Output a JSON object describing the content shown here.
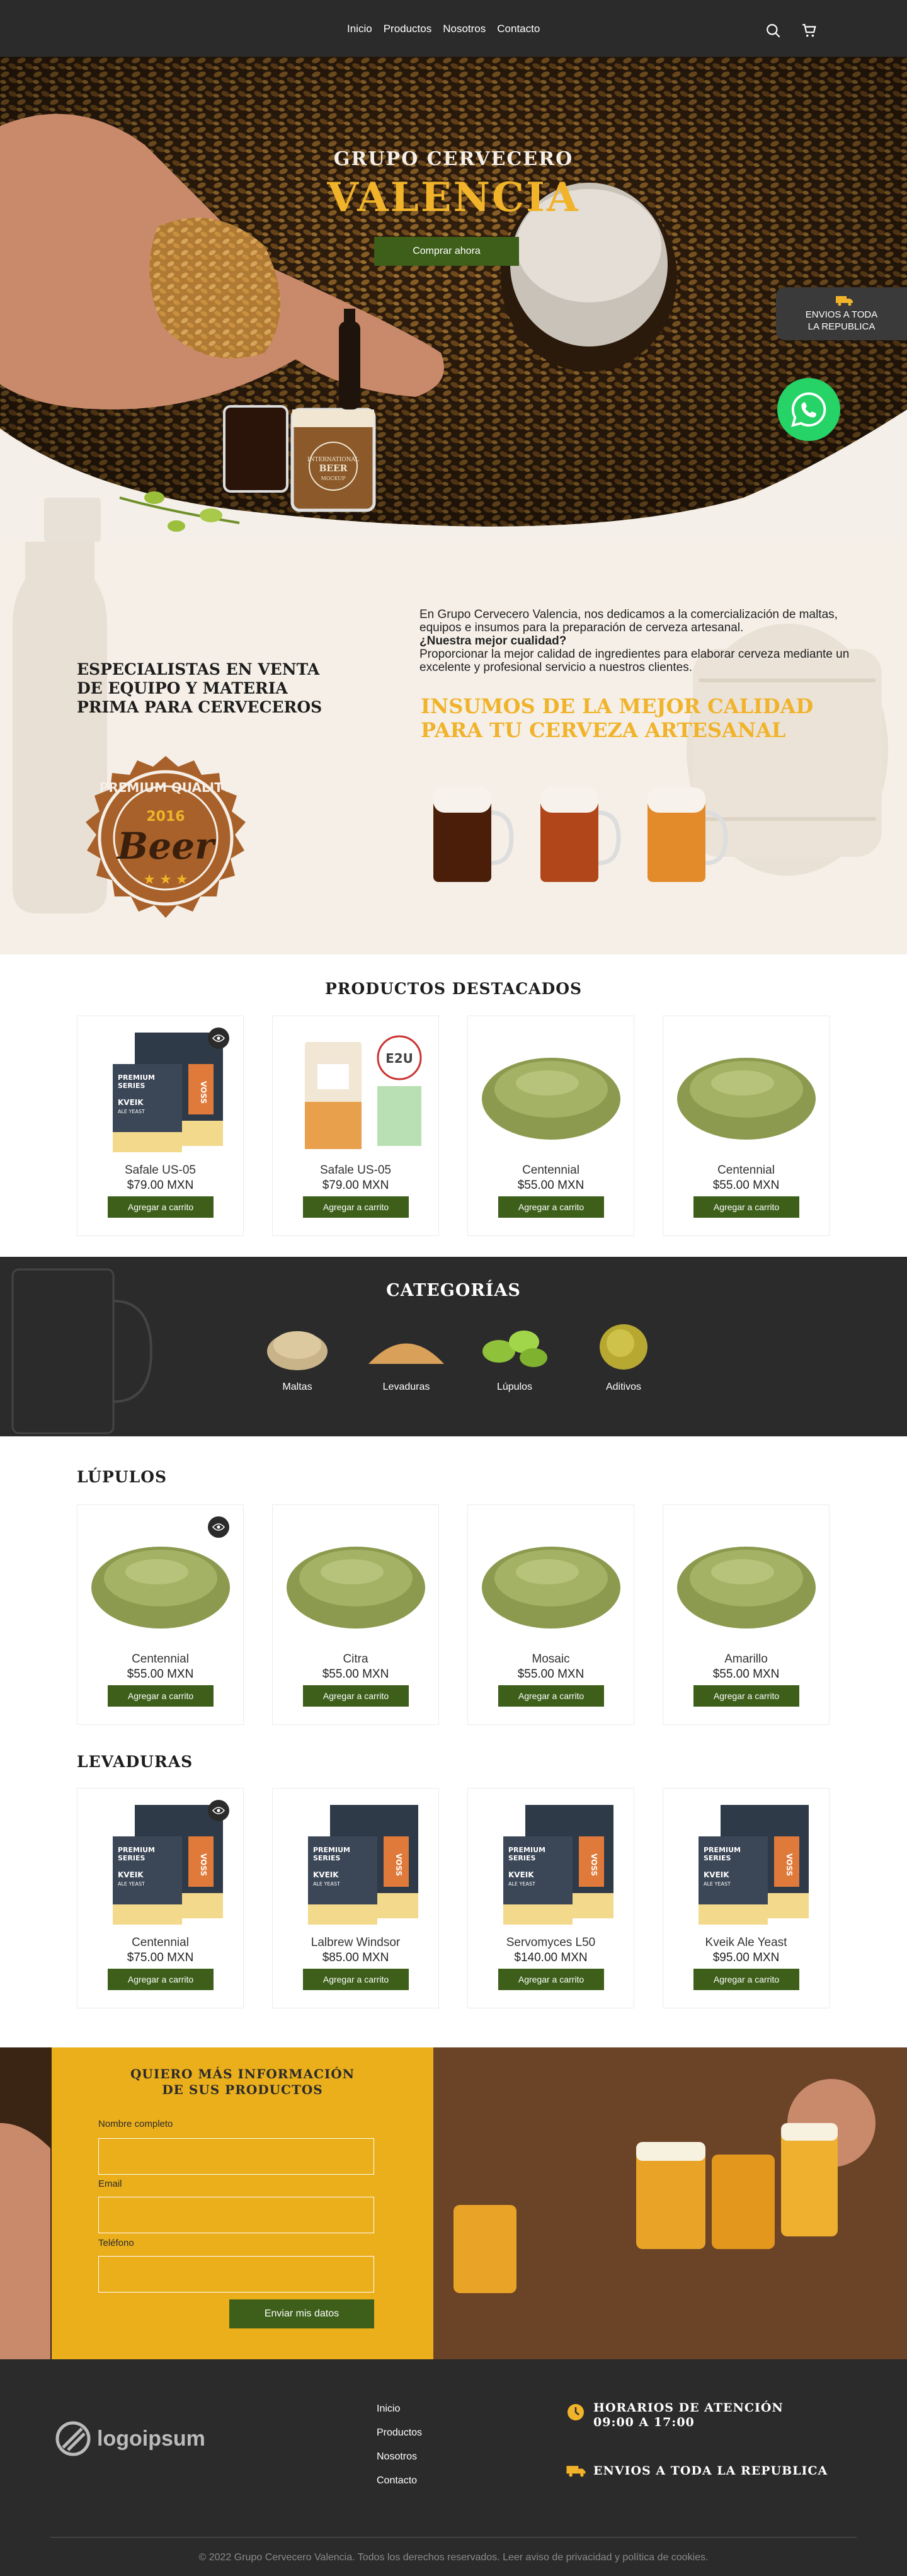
{
  "nav": {
    "links": [
      "Inicio",
      "Productos",
      "Nosotros",
      "Contacto"
    ],
    "icons": [
      "search-icon",
      "cart-icon"
    ]
  },
  "hero": {
    "title_small": "GRUPO CERVECERO",
    "title_big": "VALENCIA",
    "cta": "Comprar ahora",
    "shipping_badge": [
      "ENVIOS A TODA",
      "LA REPUBLICA"
    ],
    "mug_label": [
      "INTERNATIONAL",
      "BEER",
      "MOCKUP"
    ]
  },
  "intro": {
    "left_title": "ESPECIALISTAS EN VENTA DE EQUIPO Y MATERIA PRIMA PARA CERVECEROS",
    "paragraph1": "En Grupo Cervecero Valencia, nos dedicamos a la comercialización de maltas, equipos e insumos para la preparación de cerveza artesanal.",
    "question": "¿Nuestra mejor cualidad?",
    "paragraph2": "Proporcionar la mejor calidad de ingredientes para elaborar cerveza mediante un excelente y profesional  servicio a nuestros clientes.",
    "yellow_title": [
      "INSUMOS DE LA MEJOR CALIDAD",
      "PARA TU CERVEZA ARTESANAL"
    ],
    "seal": {
      "top": "PREMIUM QUALITY",
      "year": "2016",
      "word": "Beer"
    }
  },
  "featured": {
    "title": "PRODUCTOS DESTACADOS",
    "products": [
      {
        "name": "Safale US-05",
        "price": "$79.00 MXN",
        "cta": "Agregar a carrito"
      },
      {
        "name": "Safale US-05",
        "price": "$79.00 MXN",
        "cta": "Agregar a carrito"
      },
      {
        "name": "Centennial",
        "price": "$55.00 MXN",
        "cta": "Agregar a carrito"
      },
      {
        "name": "Centennial",
        "price": "$55.00 MXN",
        "cta": "Agregar a carrito"
      }
    ]
  },
  "categories": {
    "title": "CATEGORÍAS",
    "items": [
      "Maltas",
      "Levaduras",
      "Lúpulos",
      "Aditivos"
    ]
  },
  "hops": {
    "title": "LÚPULOS",
    "products": [
      {
        "name": "Centennial",
        "price": "$55.00 MXN",
        "cta": "Agregar a carrito"
      },
      {
        "name": "Citra",
        "price": "$55.00 MXN",
        "cta": "Agregar a carrito"
      },
      {
        "name": "Mosaic",
        "price": "$55.00 MXN",
        "cta": "Agregar a carrito"
      },
      {
        "name": "Amarillo",
        "price": "$55.00 MXN",
        "cta": "Agregar a carrito"
      }
    ]
  },
  "yeasts": {
    "title": "LEVADURAS",
    "products": [
      {
        "name": "Centennial",
        "price": "$75.00 MXN",
        "cta": "Agregar a carrito"
      },
      {
        "name": "Lalbrew Windsor",
        "price": "$85.00 MXN",
        "cta": "Agregar a carrito"
      },
      {
        "name": "Servomyces L50",
        "price": "$140.00 MXN",
        "cta": "Agregar a carrito"
      },
      {
        "name": "Kveik Ale Yeast",
        "price": "$95.00 MXN",
        "cta": "Agregar a carrito"
      }
    ]
  },
  "yeast_pack": {
    "premium": "PREMIUM",
    "series": "SERIES",
    "kveik": "KVEIK",
    "ale_yeast": "ALE YEAST",
    "voss": "VOSS"
  },
  "form": {
    "title": [
      "QUIERO MÁS INFORMACIÓN",
      "DE SUS PRODUCTOS"
    ],
    "fields": [
      "Nombre completo",
      "Email",
      "Teléfono"
    ],
    "submit": "Enviar mis datos"
  },
  "footer": {
    "logo": "logoipsum",
    "links": [
      "Inicio",
      "Productos",
      "Nosotros",
      "Contacto"
    ],
    "hours_title": "HORARIOS DE ATENCIÓN",
    "hours": "09:00 A 17:00",
    "shipping": "ENVIOS A TODA LA REPUBLICA",
    "copyright": "© 2022 Grupo Cervecero Valencia. Todos los derechos reservados. Leer aviso de privacidad y política de cookies."
  },
  "colors": {
    "dark": "#2b2b2b",
    "green": "#3d5f1a",
    "yellow": "#f0b32a",
    "cream": "#f5efe7"
  }
}
